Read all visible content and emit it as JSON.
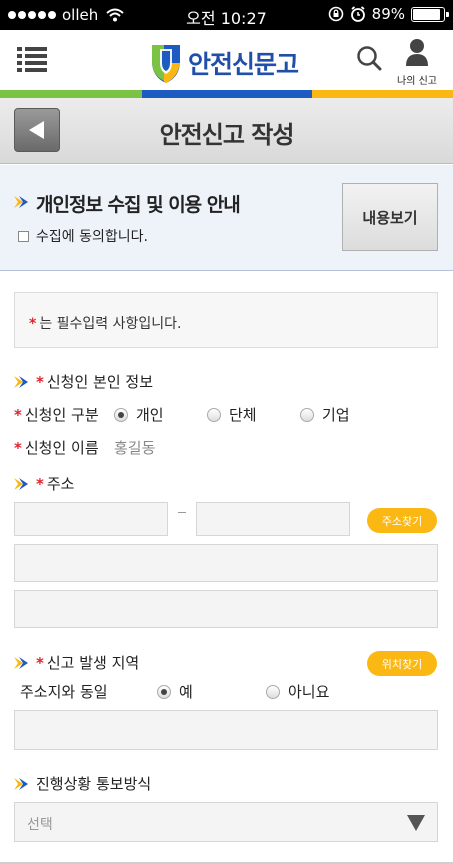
{
  "status_bar": {
    "carrier": "olleh",
    "time": "오전 10:27",
    "battery": "89%",
    "battery_level": 0.89
  },
  "header": {
    "logo_text": "안전신문고",
    "my_report_label": "나의 신고"
  },
  "titlebar": {
    "title": "안전신고 작성"
  },
  "privacy": {
    "title": "개인정보 수집 및 이용 안내",
    "agree_label": "수집에 동의합니다.",
    "view_button": "내용보기"
  },
  "form": {
    "required_notice": "는 필수입력 사항입니다.",
    "required_mark": "*",
    "applicant_section": "신청인 본인 정보",
    "applicant_type_label": "신청인 구분",
    "applicant_types": [
      "개인",
      "단체",
      "기업"
    ],
    "applicant_type_selected": "개인",
    "applicant_name_label": "신청인 이름",
    "applicant_name_value": "홍길동",
    "address_section": "주소",
    "address_search_button": "주소찾기",
    "location_section": "신고 발생 지역",
    "location_search_button": "위치찾기",
    "same_as_address_label": "주소지와 동일",
    "same_options": [
      "예",
      "아니요"
    ],
    "same_selected": "예",
    "progress_section": "진행상황 통보방식",
    "progress_select_value": "선택"
  }
}
